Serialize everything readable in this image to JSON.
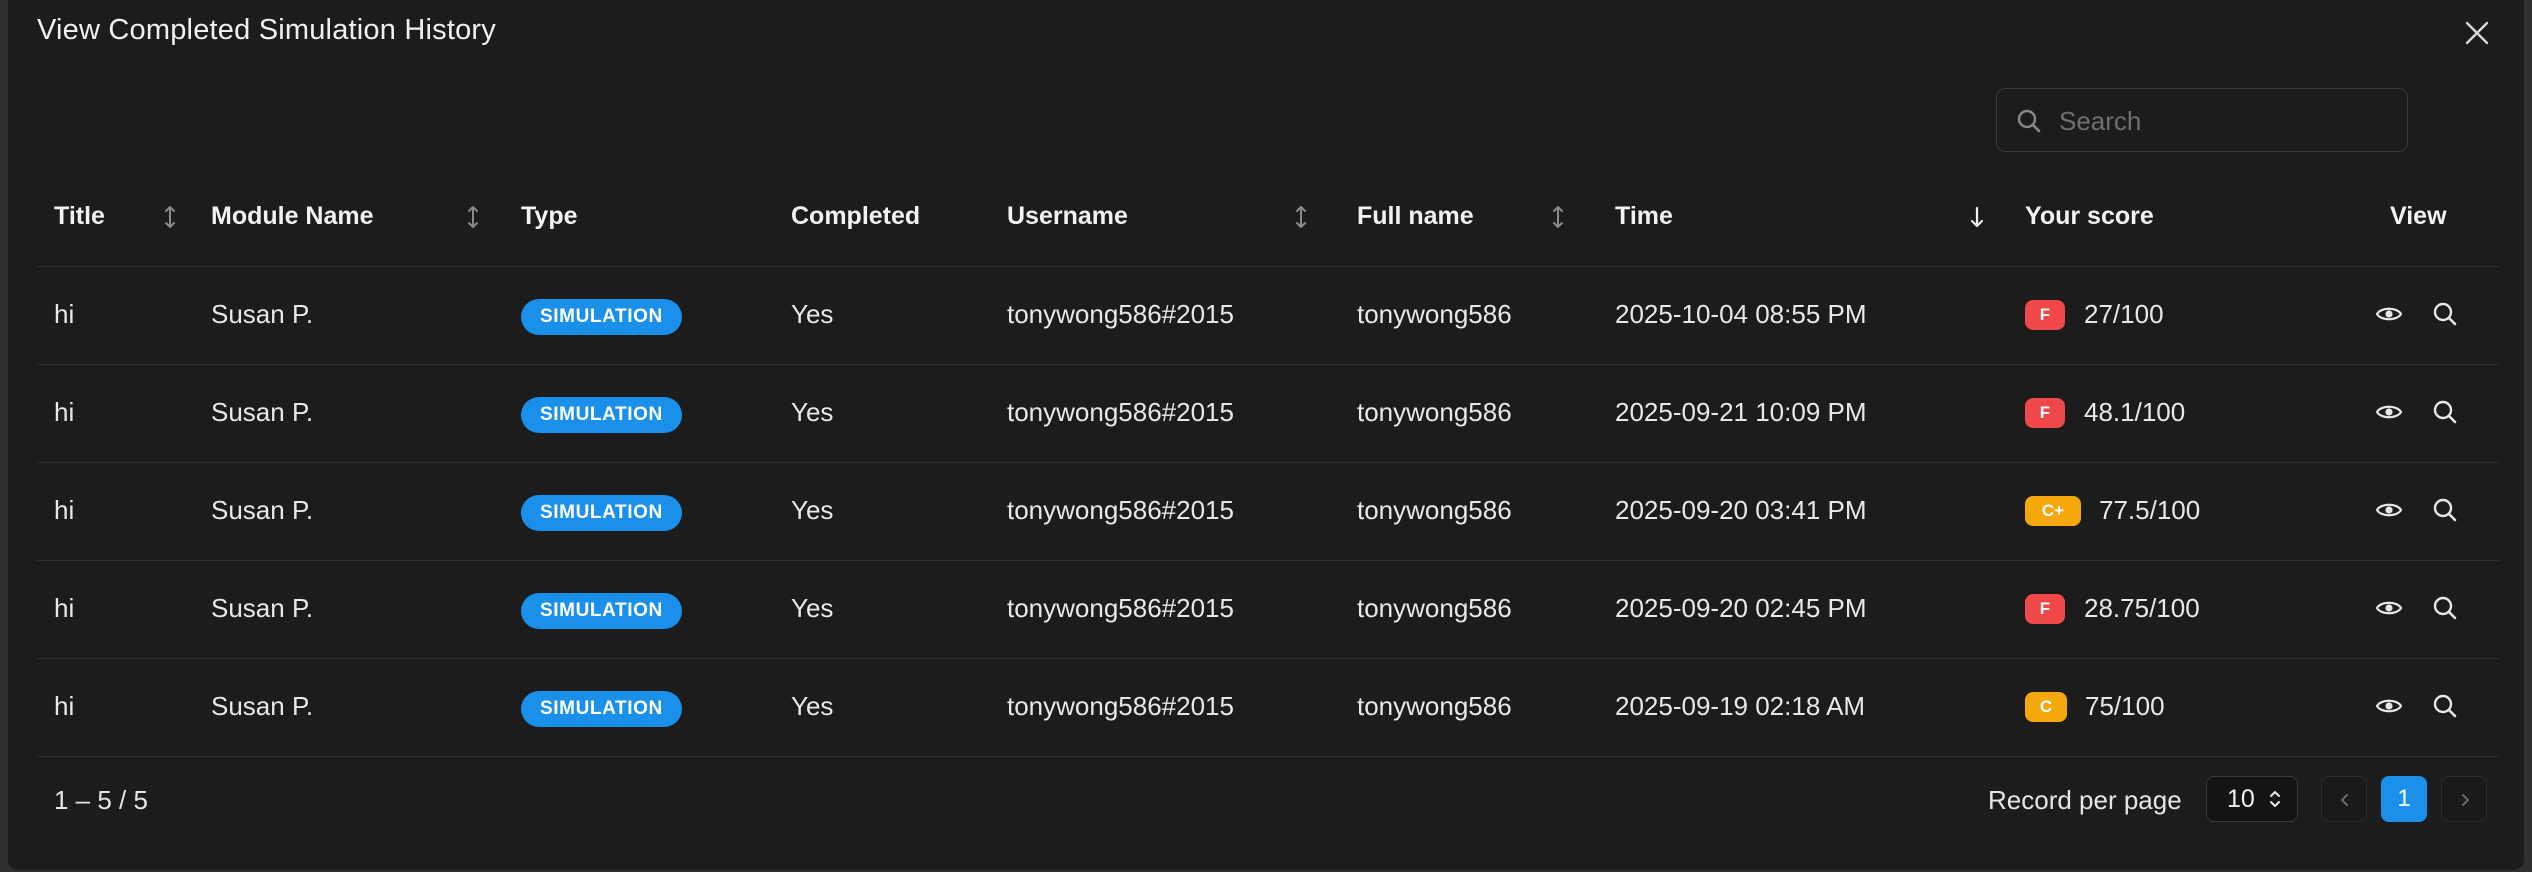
{
  "modal": {
    "title": "View Completed Simulation History"
  },
  "search": {
    "placeholder": "Search",
    "value": ""
  },
  "table": {
    "columns": [
      {
        "label": "Title",
        "sortable": true
      },
      {
        "label": "Module Name",
        "sortable": true
      },
      {
        "label": "Type",
        "sortable": false
      },
      {
        "label": "Completed",
        "sortable": false
      },
      {
        "label": "Username",
        "sortable": true
      },
      {
        "label": "Full name",
        "sortable": true
      },
      {
        "label": "Time",
        "sortable": true,
        "sort": "desc"
      },
      {
        "label": "Your score",
        "sortable": false
      },
      {
        "label": "View",
        "sortable": false
      }
    ],
    "rows": [
      {
        "title": "hi",
        "module": "Susan P.",
        "type": "SIMULATION",
        "completed": "Yes",
        "username": "tonywong586#2015",
        "fullname": "tonywong586",
        "time": "2025-10-04 08:55 PM",
        "grade": "F",
        "grade_color": "#f04848",
        "score": "27/100"
      },
      {
        "title": "hi",
        "module": "Susan P.",
        "type": "SIMULATION",
        "completed": "Yes",
        "username": "tonywong586#2015",
        "fullname": "tonywong586",
        "time": "2025-09-21 10:09 PM",
        "grade": "F",
        "grade_color": "#f04848",
        "score": "48.1/100"
      },
      {
        "title": "hi",
        "module": "Susan P.",
        "type": "SIMULATION",
        "completed": "Yes",
        "username": "tonywong586#2015",
        "fullname": "tonywong586",
        "time": "2025-09-20 03:41 PM",
        "grade": "C+",
        "grade_color": "#f4a80c",
        "score": "77.5/100"
      },
      {
        "title": "hi",
        "module": "Susan P.",
        "type": "SIMULATION",
        "completed": "Yes",
        "username": "tonywong586#2015",
        "fullname": "tonywong586",
        "time": "2025-09-20 02:45 PM",
        "grade": "F",
        "grade_color": "#f04848",
        "score": "28.75/100"
      },
      {
        "title": "hi",
        "module": "Susan P.",
        "type": "SIMULATION",
        "completed": "Yes",
        "username": "tonywong586#2015",
        "fullname": "tonywong586",
        "time": "2025-09-19 02:18 AM",
        "grade": "C",
        "grade_color": "#f4a80c",
        "score": "75/100"
      }
    ]
  },
  "footer": {
    "range": "1 – 5 / 5",
    "rpp_label": "Record per page",
    "rpp_value": "10",
    "current_page": "1"
  },
  "colors": {
    "accent": "#1a90ea",
    "fail": "#f04848",
    "warn": "#f4a80c",
    "background": "#1c1c1c"
  },
  "icons": {
    "close": "close-icon",
    "search": "search-icon",
    "sort": "sort-icon",
    "sort_desc": "arrow-down-icon",
    "view": "eye-icon",
    "inspect": "magnifier-icon",
    "prev": "chevron-left-icon",
    "next": "chevron-right-icon"
  }
}
